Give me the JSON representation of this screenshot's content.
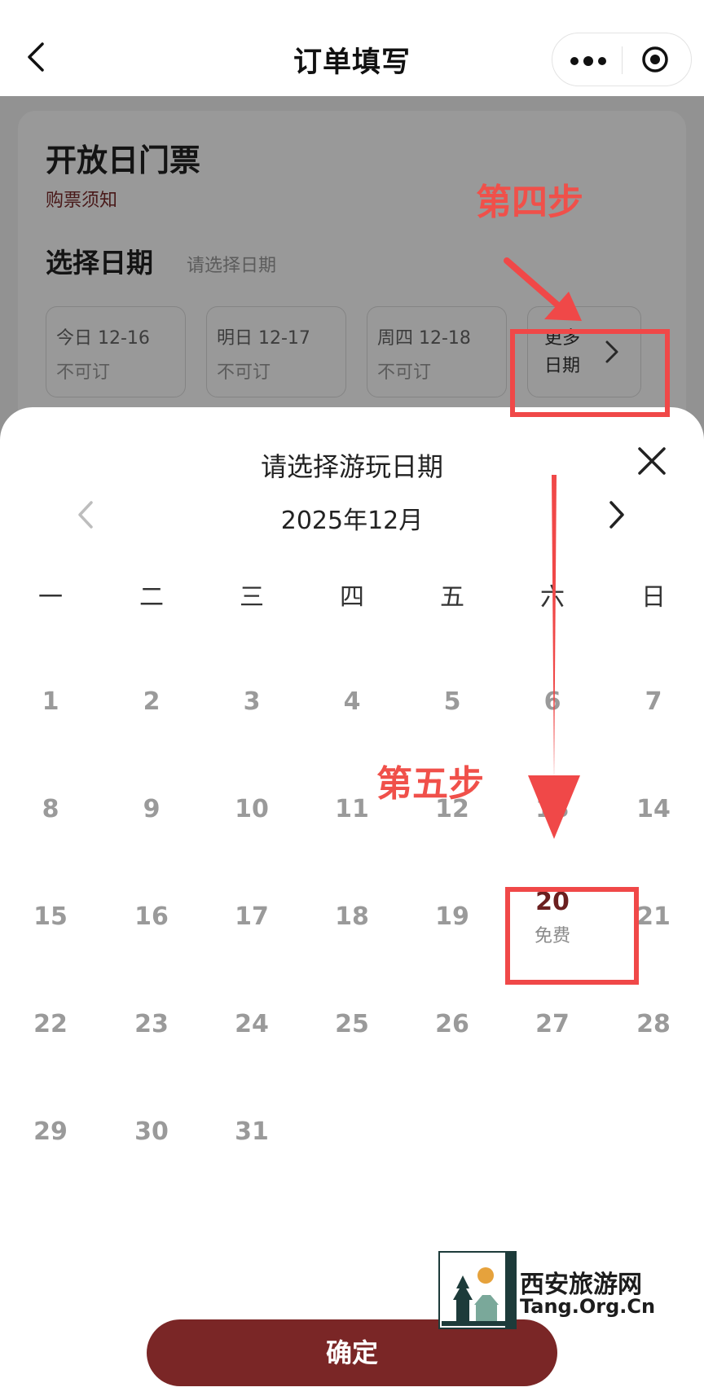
{
  "nav": {
    "title": "订单填写"
  },
  "product": {
    "name": "开放日门票",
    "notice_link": "购票须知",
    "select_date_label": "选择日期",
    "select_date_hint": "请选择日期",
    "date_chips": [
      {
        "date": "今日 12-16",
        "status": "不可订"
      },
      {
        "date": "明日 12-17",
        "status": "不可订"
      },
      {
        "date": "周四 12-18",
        "status": "不可订"
      }
    ],
    "more_dates_label": "更多日期"
  },
  "sheet": {
    "title": "请选择游玩日期",
    "month": "2025年12月",
    "weekdays": [
      "一",
      "二",
      "三",
      "四",
      "五",
      "六",
      "日"
    ],
    "days": [
      "1",
      "2",
      "3",
      "4",
      "5",
      "6",
      "7",
      "8",
      "9",
      "10",
      "11",
      "12",
      "13",
      "14",
      "15",
      "16",
      "17",
      "18",
      "19",
      "20",
      "21",
      "22",
      "23",
      "24",
      "25",
      "26",
      "27",
      "28",
      "29",
      "30",
      "31"
    ],
    "available_day": "20",
    "available_day_note": "免费",
    "confirm_label": "确定"
  },
  "annotations": {
    "step4": "第四步",
    "step5": "第五步"
  },
  "watermark": {
    "name": "西安旅游网",
    "url": "Tang.Org.Cn"
  },
  "colors": {
    "accent": "#7a2626",
    "annotation": "#f04848",
    "available_day": "#6b1f1f"
  }
}
